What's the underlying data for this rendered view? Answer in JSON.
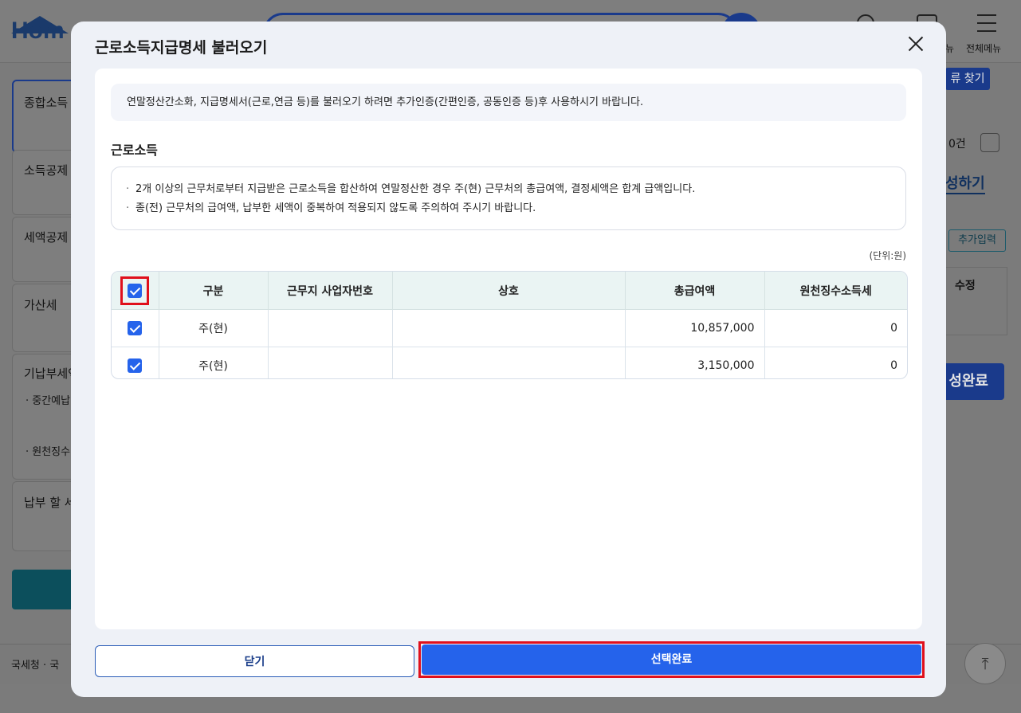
{
  "background": {
    "logo_text": "Hom",
    "menu_label": "전체메뉴",
    "menu_small": "뉴",
    "sidebar": [
      {
        "label": "종합소득"
      },
      {
        "label": "소득공제"
      },
      {
        "label": "세액공제"
      },
      {
        "label": "가산세"
      },
      {
        "label": "기납부세액"
      },
      {
        "label": "납부 할 세"
      }
    ],
    "sidebar_sub": [
      "· 중간예납",
      "· 원천징수"
    ],
    "right_find": "류 찾기",
    "right_count": "0건",
    "right_write": "성하기",
    "right_add": "추가입력",
    "right_th": "수정",
    "right_done": "성완료",
    "footer_text": "국세청 · 국",
    "top_icon": "⤒"
  },
  "modal": {
    "title": "근로소득지급명세 불러오기",
    "close_icon": "close-icon",
    "notice": "연말정산간소화, 지급명세서(근로,연금 등)를 불러오기 하려면 추가인증(간편인증, 공동인증 등)후 사용하시기 바랍니다.",
    "section_title": "근로소득",
    "info": [
      "2개 이상의 근무처로부터 지급받은 근로소득을 합산하여 연말정산한 경우 주(현) 근무처의 총급여액, 결정세액은 합계 급액입니다.",
      "종(전) 근무처의 급여액, 납부한 세액이 중복하여 적용되지 않도록 주의하여 주시기 바랍니다."
    ],
    "unit": "(단위:원)",
    "table": {
      "headers": [
        "구분",
        "근무지 사업자번호",
        "상호",
        "총급여액",
        "원천징수소득세"
      ],
      "rows": [
        {
          "type": "주(현)",
          "bizno": "",
          "name": "",
          "total": "10,857,000",
          "tax": "0",
          "checked": true
        },
        {
          "type": "주(현)",
          "bizno": "",
          "name": "",
          "total": "3,150,000",
          "tax": "0",
          "checked": true
        }
      ]
    },
    "buttons": {
      "close": "닫기",
      "done": "선택완료"
    }
  }
}
